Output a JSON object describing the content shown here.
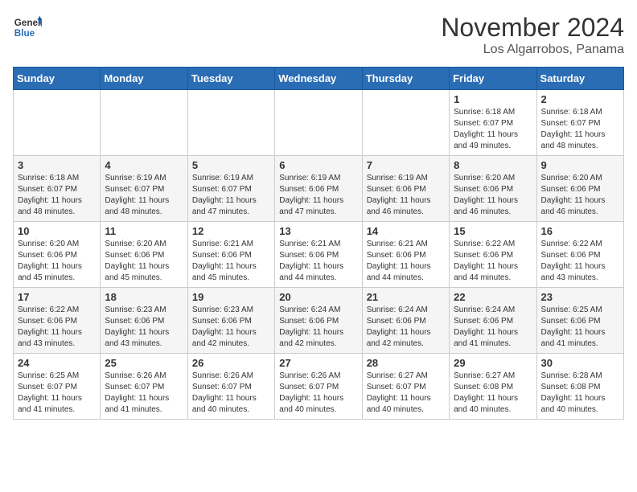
{
  "header": {
    "logo_line1": "General",
    "logo_line2": "Blue",
    "month": "November 2024",
    "location": "Los Algarrobos, Panama"
  },
  "weekdays": [
    "Sunday",
    "Monday",
    "Tuesday",
    "Wednesday",
    "Thursday",
    "Friday",
    "Saturday"
  ],
  "weeks": [
    [
      {
        "day": "",
        "info": ""
      },
      {
        "day": "",
        "info": ""
      },
      {
        "day": "",
        "info": ""
      },
      {
        "day": "",
        "info": ""
      },
      {
        "day": "",
        "info": ""
      },
      {
        "day": "1",
        "info": "Sunrise: 6:18 AM\nSunset: 6:07 PM\nDaylight: 11 hours\nand 49 minutes."
      },
      {
        "day": "2",
        "info": "Sunrise: 6:18 AM\nSunset: 6:07 PM\nDaylight: 11 hours\nand 48 minutes."
      }
    ],
    [
      {
        "day": "3",
        "info": "Sunrise: 6:18 AM\nSunset: 6:07 PM\nDaylight: 11 hours\nand 48 minutes."
      },
      {
        "day": "4",
        "info": "Sunrise: 6:19 AM\nSunset: 6:07 PM\nDaylight: 11 hours\nand 48 minutes."
      },
      {
        "day": "5",
        "info": "Sunrise: 6:19 AM\nSunset: 6:07 PM\nDaylight: 11 hours\nand 47 minutes."
      },
      {
        "day": "6",
        "info": "Sunrise: 6:19 AM\nSunset: 6:06 PM\nDaylight: 11 hours\nand 47 minutes."
      },
      {
        "day": "7",
        "info": "Sunrise: 6:19 AM\nSunset: 6:06 PM\nDaylight: 11 hours\nand 46 minutes."
      },
      {
        "day": "8",
        "info": "Sunrise: 6:20 AM\nSunset: 6:06 PM\nDaylight: 11 hours\nand 46 minutes."
      },
      {
        "day": "9",
        "info": "Sunrise: 6:20 AM\nSunset: 6:06 PM\nDaylight: 11 hours\nand 46 minutes."
      }
    ],
    [
      {
        "day": "10",
        "info": "Sunrise: 6:20 AM\nSunset: 6:06 PM\nDaylight: 11 hours\nand 45 minutes."
      },
      {
        "day": "11",
        "info": "Sunrise: 6:20 AM\nSunset: 6:06 PM\nDaylight: 11 hours\nand 45 minutes."
      },
      {
        "day": "12",
        "info": "Sunrise: 6:21 AM\nSunset: 6:06 PM\nDaylight: 11 hours\nand 45 minutes."
      },
      {
        "day": "13",
        "info": "Sunrise: 6:21 AM\nSunset: 6:06 PM\nDaylight: 11 hours\nand 44 minutes."
      },
      {
        "day": "14",
        "info": "Sunrise: 6:21 AM\nSunset: 6:06 PM\nDaylight: 11 hours\nand 44 minutes."
      },
      {
        "day": "15",
        "info": "Sunrise: 6:22 AM\nSunset: 6:06 PM\nDaylight: 11 hours\nand 44 minutes."
      },
      {
        "day": "16",
        "info": "Sunrise: 6:22 AM\nSunset: 6:06 PM\nDaylight: 11 hours\nand 43 minutes."
      }
    ],
    [
      {
        "day": "17",
        "info": "Sunrise: 6:22 AM\nSunset: 6:06 PM\nDaylight: 11 hours\nand 43 minutes."
      },
      {
        "day": "18",
        "info": "Sunrise: 6:23 AM\nSunset: 6:06 PM\nDaylight: 11 hours\nand 43 minutes."
      },
      {
        "day": "19",
        "info": "Sunrise: 6:23 AM\nSunset: 6:06 PM\nDaylight: 11 hours\nand 42 minutes."
      },
      {
        "day": "20",
        "info": "Sunrise: 6:24 AM\nSunset: 6:06 PM\nDaylight: 11 hours\nand 42 minutes."
      },
      {
        "day": "21",
        "info": "Sunrise: 6:24 AM\nSunset: 6:06 PM\nDaylight: 11 hours\nand 42 minutes."
      },
      {
        "day": "22",
        "info": "Sunrise: 6:24 AM\nSunset: 6:06 PM\nDaylight: 11 hours\nand 41 minutes."
      },
      {
        "day": "23",
        "info": "Sunrise: 6:25 AM\nSunset: 6:06 PM\nDaylight: 11 hours\nand 41 minutes."
      }
    ],
    [
      {
        "day": "24",
        "info": "Sunrise: 6:25 AM\nSunset: 6:07 PM\nDaylight: 11 hours\nand 41 minutes."
      },
      {
        "day": "25",
        "info": "Sunrise: 6:26 AM\nSunset: 6:07 PM\nDaylight: 11 hours\nand 41 minutes."
      },
      {
        "day": "26",
        "info": "Sunrise: 6:26 AM\nSunset: 6:07 PM\nDaylight: 11 hours\nand 40 minutes."
      },
      {
        "day": "27",
        "info": "Sunrise: 6:26 AM\nSunset: 6:07 PM\nDaylight: 11 hours\nand 40 minutes."
      },
      {
        "day": "28",
        "info": "Sunrise: 6:27 AM\nSunset: 6:07 PM\nDaylight: 11 hours\nand 40 minutes."
      },
      {
        "day": "29",
        "info": "Sunrise: 6:27 AM\nSunset: 6:08 PM\nDaylight: 11 hours\nand 40 minutes."
      },
      {
        "day": "30",
        "info": "Sunrise: 6:28 AM\nSunset: 6:08 PM\nDaylight: 11 hours\nand 40 minutes."
      }
    ]
  ]
}
